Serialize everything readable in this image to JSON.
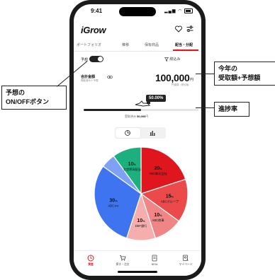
{
  "status_bar": {
    "time": "9:41"
  },
  "app": {
    "logo": "iGrow"
  },
  "tabs": [
    {
      "label": "ポートフォリオ",
      "active": false
    },
    {
      "label": "推移",
      "active": false
    },
    {
      "label": "保有商品",
      "active": false
    },
    {
      "label": "配当・分配",
      "active": true
    }
  ],
  "forecast": {
    "label": "予想",
    "on": true
  },
  "filter": {
    "label": "絞込み"
  },
  "summary": {
    "label": "合計金額",
    "sublabel": "受取済み＋予想",
    "value": "100,000",
    "unit": "円",
    "value_sub": "円換算・税引後"
  },
  "progress": {
    "percent_label": "50.00%",
    "fraction": 0.5,
    "caption_label": "受取済み",
    "caption_value": "50,000",
    "caption_unit": "円"
  },
  "view_toggle": {
    "options": [
      "pie-chart-icon",
      "bar-chart-icon"
    ],
    "selected": "pie-chart-icon"
  },
  "chart_data": {
    "type": "pie",
    "slices": [
      {
        "label": "ABC株式会社",
        "value": 20,
        "color": "#e0161e"
      },
      {
        "label": "ABCグループ",
        "value": 15,
        "color": "#ec4a4a"
      },
      {
        "label": "ABC商事",
        "value": 10,
        "color": "#f08585"
      },
      {
        "label": "DEF銀行",
        "value": 10,
        "color": "#f6adad"
      },
      {
        "label": "ABC.inc",
        "value": 30,
        "color": "#3e74f0"
      },
      {
        "label": "",
        "value": 5,
        "color": "#7fa1f4"
      },
      {
        "label": "全世界高配当",
        "value": 10,
        "color": "#1bb07d"
      }
    ],
    "unit": "%"
  },
  "bottom_nav": [
    {
      "label": "資産",
      "icon": "clock-icon",
      "active": true
    },
    {
      "label": "探す・注文",
      "icon": "cart-icon",
      "active": false
    },
    {
      "label": "NISA",
      "icon": "document-icon",
      "active": false
    },
    {
      "label": "マイページ",
      "icon": "user-card-icon",
      "active": false
    }
  ],
  "callouts": {
    "forecast_toggle": "予想の\nON/OFFボタン",
    "received_total": "今年の\n受取額+予想額",
    "progress_rate": "進捗率"
  }
}
